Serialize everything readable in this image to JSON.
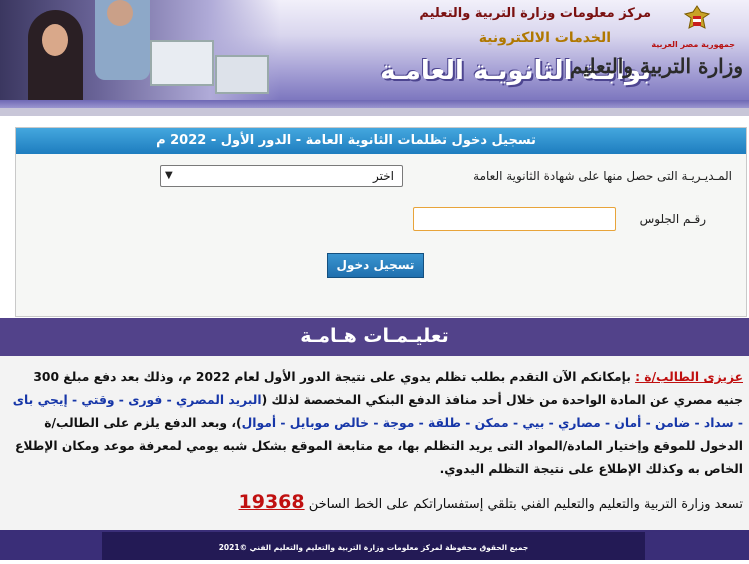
{
  "header": {
    "center_name": "مركز معلومات وزارة التربية والتعليم",
    "services": "الخدمات الالكترونية",
    "portal_title": "بوابـة الثانويـة العامـة",
    "logo_caption": "جمهورية مصر العربية",
    "logo_name": "وزارة التربية والتعليم"
  },
  "form": {
    "title": "تسجيل دخول تظلمات الثانوية العامة - الدور الأول - 2022 م",
    "directorate_label": "المـديـريـة التى حصل منها على شهادة الثانوية العامة",
    "directorate_value": "اختر",
    "seat_label": "رقـم الجلوس",
    "seat_value": "",
    "login_button": "تسجيل دخول"
  },
  "notice": {
    "title": "تعليـمـات هـامـة",
    "greeting": "عزيزى الطالب/ة :",
    "p1": "بإمكانكم الآن التقدم بطلب تظلم يدوي على نتيجة الدور الأول لعام 2022 م، وذلك بعد دفع مبلغ 300 جنيه مصري عن المادة الواحدة من خلال أحد منافذ الدفع البنكي المخصصة لذلك (",
    "payment_channels": "البريد المصري - فورى - وقتي - إيجي باى - سداد - ضامن - أمان - مصاري - بيي - ممكن - طلقة - موجة - خالص موبايل - أموال",
    "p2": ")، وبعد الدفع يلزم على الطالب/ة الدخول للموقع وإختيار المادة/المواد التى يريد التظلم بها، مع متابعة الموقع بشكل شبه يومي لمعرفة موعد ومكان الإطلاع الخاص به وكذلك الإطلاع على نتيجة التظلم اليدوي.",
    "hotline_text": "تسعد وزارة التربية والتعليم والتعليم الفني بتلقي إستفساراتكم على الخط الساخن",
    "hotline_number": "19368"
  },
  "footer": {
    "copyright": "جميع الحقوق محفوظة لمركز معلومات وزارة التربية والتعليم والتعليم الفني ©2021"
  }
}
